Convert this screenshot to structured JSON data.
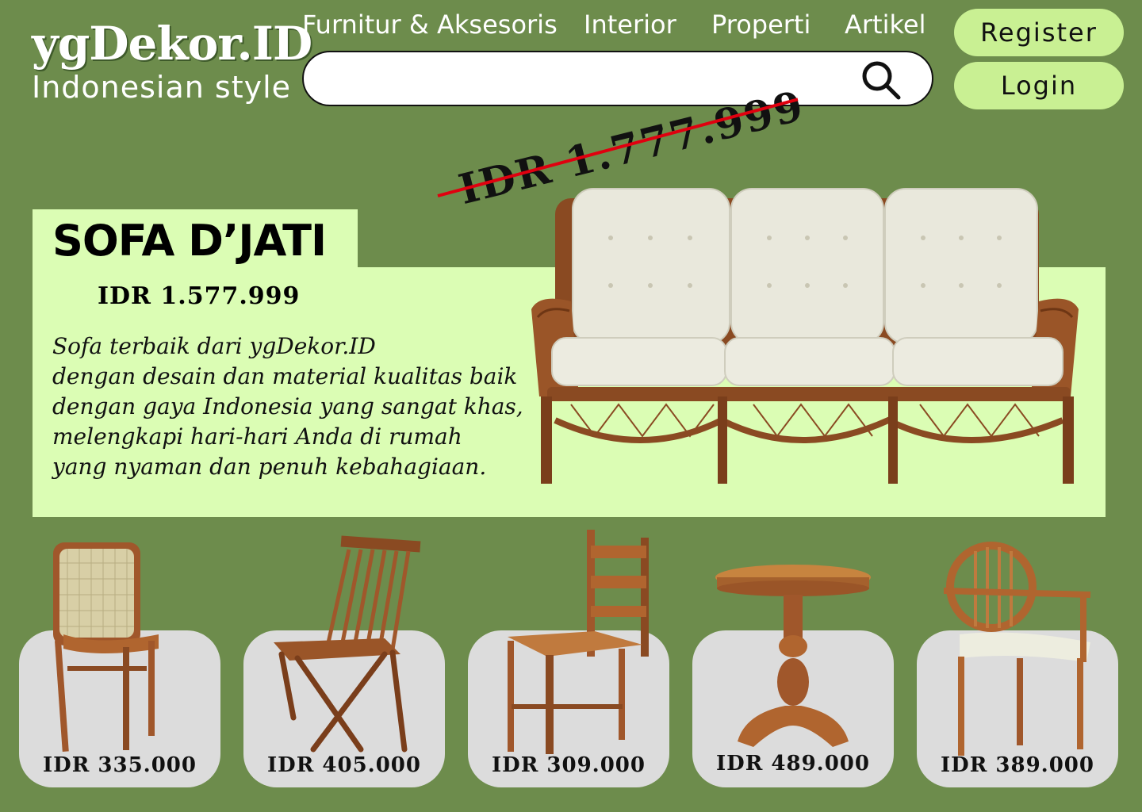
{
  "brand": {
    "name": "ygDekor.ID",
    "tagline": "Indonesian style"
  },
  "nav": {
    "items": [
      "Furnitur & Aksesoris",
      "Interior",
      "Properti",
      "Artikel"
    ]
  },
  "search": {
    "value": "",
    "placeholder": "",
    "icon": "search-icon"
  },
  "auth": {
    "register_label": "Register",
    "login_label": "Login"
  },
  "hero": {
    "title": "SOFA D’JATI",
    "price": "IDR 1.577.999",
    "old_price": "IDR 1.777.999",
    "description": [
      "Sofa terbaik dari ygDekor.ID",
      "dengan desain dan material kualitas baik",
      "dengan gaya Indonesia yang sangat khas,",
      "melengkapi hari-hari Anda di rumah",
      "yang nyaman dan penuh kebahagiaan."
    ]
  },
  "products": [
    {
      "image": "rattan-back-chair",
      "price": "IDR 335.000"
    },
    {
      "image": "folding-chair",
      "price": "IDR 405.000"
    },
    {
      "image": "ladder-back-chair",
      "price": "IDR 309.000"
    },
    {
      "image": "round-pedestal-table",
      "price": "IDR 489.000"
    },
    {
      "image": "cushioned-armchair",
      "price": "IDR 389.000"
    }
  ],
  "colors": {
    "background": "#6d8c4c",
    "hero_panel": "#dbfdb4",
    "button": "#c9f093",
    "card": "#dcdcdc",
    "strike": "#e0000f",
    "wood": "#a0572b"
  }
}
